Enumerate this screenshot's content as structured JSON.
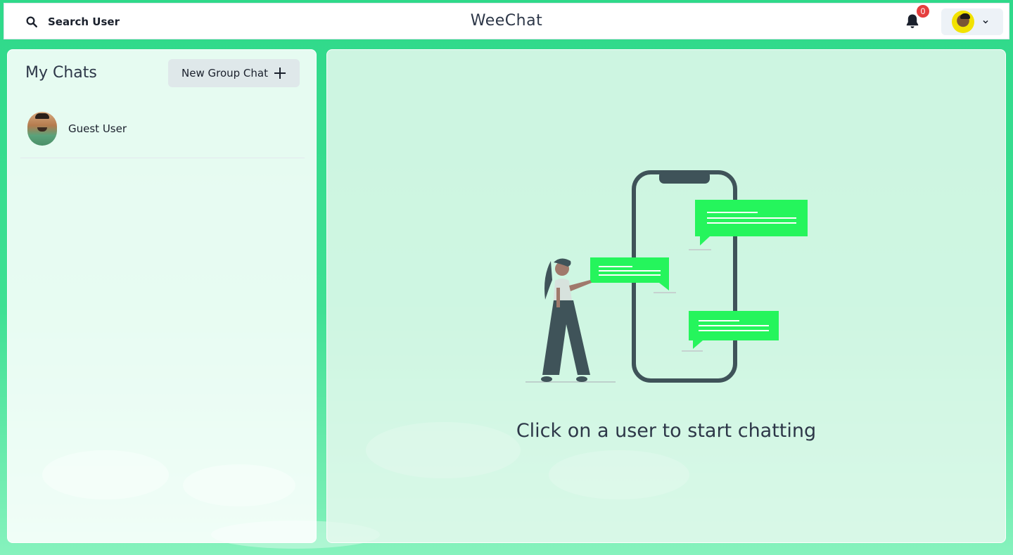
{
  "header": {
    "search_label": "Search User",
    "app_title": "WeeChat",
    "notification_count": "0"
  },
  "sidebar": {
    "title": "My Chats",
    "new_group_label": "New Group Chat",
    "chats": [
      {
        "name": "Guest User"
      }
    ]
  },
  "main": {
    "empty_message": "Click on a user to start chatting"
  },
  "colors": {
    "accent": "#25f55c",
    "dark": "#3f5359",
    "badge": "#e53e3e"
  }
}
